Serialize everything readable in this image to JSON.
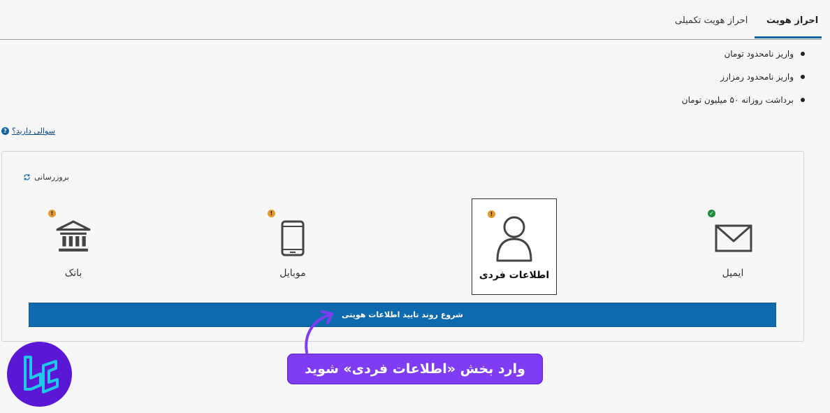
{
  "tabs": [
    {
      "label": "احراز هویت",
      "active": true
    },
    {
      "label": "احراز هویت تکمیلی",
      "active": false
    }
  ],
  "benefits": [
    "واریز نامحدود تومان",
    "واریز نامحدود رمزارز",
    "برداشت روزانه ۵۰ میلیون تومان"
  ],
  "help": {
    "label": "سوالی دارید؟",
    "icon": "question-circle-icon"
  },
  "panel": {
    "refresh_label": "بروزرسانی",
    "steps": [
      {
        "label": "بانک",
        "icon": "bank-icon",
        "status": "warning"
      },
      {
        "label": "موبایل",
        "icon": "mobile-icon",
        "status": "warning"
      },
      {
        "label": "اطلاعات فردی",
        "icon": "user-icon",
        "status": "warning",
        "selected": true
      },
      {
        "label": "ایمیل",
        "icon": "envelope-icon",
        "status": "verified"
      }
    ],
    "start_button": "شروع روند تایید اطلاعات هویتی"
  },
  "callout": {
    "text": "وارد بخش «اطلاعات فردی» شوید"
  },
  "colors": {
    "primary": "#0f69ad",
    "warning": "#e39a2a",
    "success": "#1e8a3c",
    "callout": "#7e3df2",
    "logo_bg": "#5b17d6",
    "logo_stroke": "#1ec8e6"
  }
}
